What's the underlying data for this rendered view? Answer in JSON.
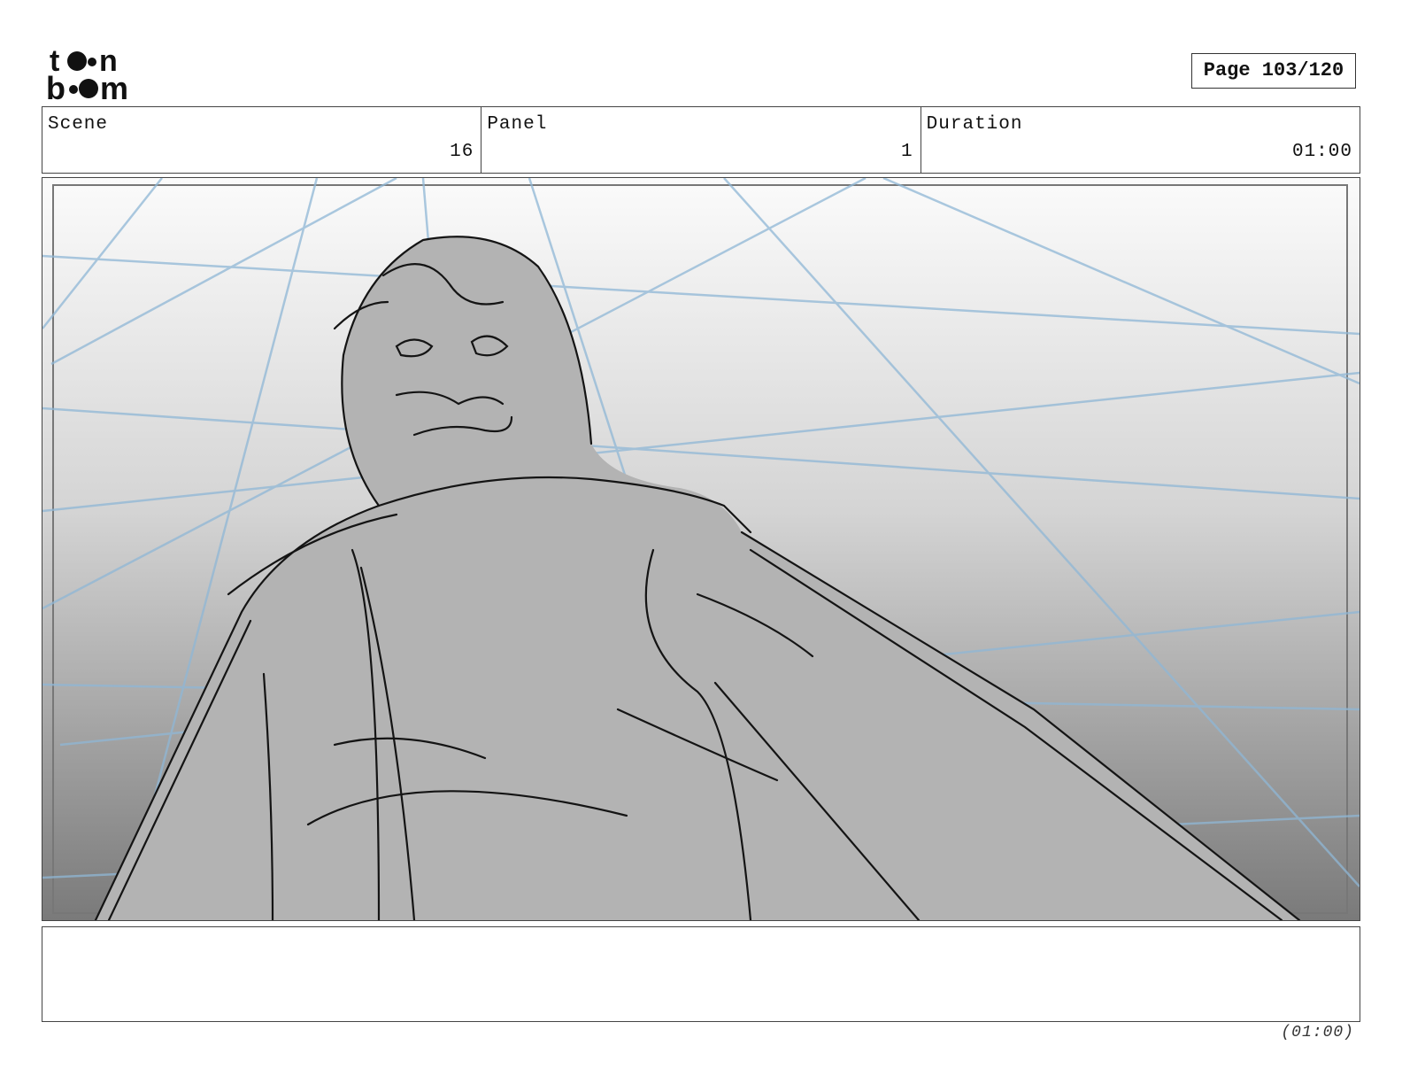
{
  "logo": {
    "line1": "toon",
    "line2": "boom",
    "alt": "toon boom"
  },
  "page": {
    "label": "Page 103/120"
  },
  "header": {
    "scene": {
      "label": "Scene",
      "value": "16"
    },
    "panel": {
      "label": "Panel",
      "value": "1"
    },
    "duration": {
      "label": "Duration",
      "value": "01:00"
    }
  },
  "panel_image": {
    "description_icon": "storyboard-sketch-image"
  },
  "notes": {
    "text": ""
  },
  "footer": {
    "duration": "(01:00)"
  }
}
